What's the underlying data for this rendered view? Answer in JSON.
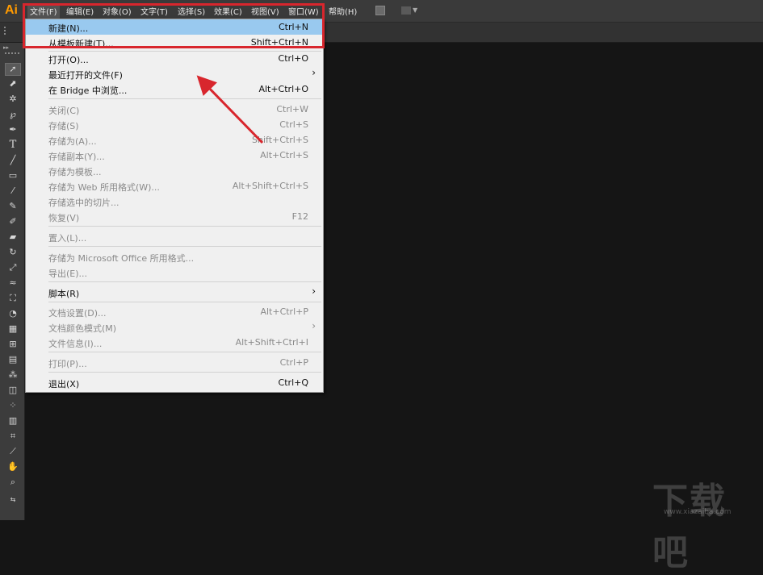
{
  "app_logo": "Ai",
  "menubar": {
    "items": [
      "文件(F)",
      "编辑(E)",
      "对象(O)",
      "文字(T)",
      "选择(S)",
      "效果(C)",
      "视图(V)",
      "窗口(W)",
      "帮助(H)"
    ]
  },
  "file_menu": {
    "items": [
      {
        "label": "新建(N)...",
        "shortcut": "Ctrl+N",
        "enabled": true,
        "highlighted": true
      },
      {
        "label": "从模板新建(T)...",
        "shortcut": "Shift+Ctrl+N",
        "enabled": true
      },
      {
        "label": "打开(O)...",
        "shortcut": "Ctrl+O",
        "enabled": true
      },
      {
        "label": "最近打开的文件(F)",
        "shortcut": "",
        "enabled": true,
        "submenu": true
      },
      {
        "label": "在 Bridge 中浏览...",
        "shortcut": "Alt+Ctrl+O",
        "enabled": true
      },
      {
        "label": "关闭(C)",
        "shortcut": "Ctrl+W",
        "enabled": false
      },
      {
        "label": "存储(S)",
        "shortcut": "Ctrl+S",
        "enabled": false
      },
      {
        "label": "存储为(A)...",
        "shortcut": "Shift+Ctrl+S",
        "enabled": false
      },
      {
        "label": "存储副本(Y)...",
        "shortcut": "Alt+Ctrl+S",
        "enabled": false
      },
      {
        "label": "存储为模板...",
        "shortcut": "",
        "enabled": false
      },
      {
        "label": "存储为 Web 所用格式(W)...",
        "shortcut": "Alt+Shift+Ctrl+S",
        "enabled": false
      },
      {
        "label": "存储选中的切片...",
        "shortcut": "",
        "enabled": false
      },
      {
        "label": "恢复(V)",
        "shortcut": "F12",
        "enabled": false
      },
      {
        "label": "置入(L)...",
        "shortcut": "",
        "enabled": false
      },
      {
        "label": "存储为 Microsoft Office 所用格式...",
        "shortcut": "",
        "enabled": false
      },
      {
        "label": "导出(E)...",
        "shortcut": "",
        "enabled": false
      },
      {
        "label": "脚本(R)",
        "shortcut": "",
        "enabled": true,
        "submenu": true
      },
      {
        "label": "文档设置(D)...",
        "shortcut": "Alt+Ctrl+P",
        "enabled": false
      },
      {
        "label": "文档颜色模式(M)",
        "shortcut": "",
        "enabled": false,
        "submenu": true
      },
      {
        "label": "文件信息(I)...",
        "shortcut": "Alt+Shift+Ctrl+I",
        "enabled": false
      },
      {
        "label": "打印(P)...",
        "shortcut": "Ctrl+P",
        "enabled": false
      },
      {
        "label": "退出(X)",
        "shortcut": "Ctrl+Q",
        "enabled": true
      }
    ]
  },
  "watermark": {
    "text": "下载吧",
    "url": "www.xiazaiba.com"
  },
  "colors": {
    "accent": "#ff9a00",
    "annotation": "#d8262d",
    "highlight": "#99c9ef"
  }
}
